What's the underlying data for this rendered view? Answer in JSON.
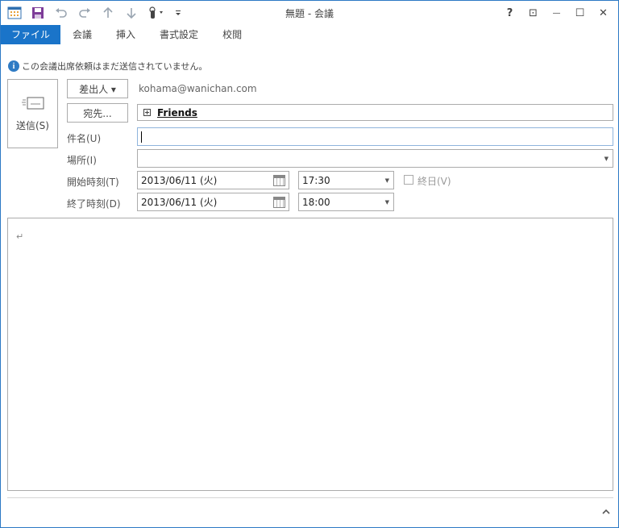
{
  "window": {
    "title": "無題 - 会議",
    "help": "?",
    "restore": "⊡",
    "minimize": "—",
    "maximize": "☐",
    "close": "✕"
  },
  "ribbon": {
    "tabs": [
      "ファイル",
      "会議",
      "挿入",
      "書式設定",
      "校閲"
    ]
  },
  "infobar": {
    "icon": "i",
    "text": "この会議出席依頼はまだ送信されていません。"
  },
  "send_button": {
    "label": "送信(S)"
  },
  "form": {
    "from_button": "差出人 ▾",
    "from_value": "kohama@wanichan.com",
    "to_button": "宛先...",
    "to_value": "Friends",
    "subject_label": "件名(U)",
    "subject_value": "",
    "location_label": "場所(I)",
    "location_value": "",
    "start_label": "開始時刻(T)",
    "start_date": "2013/06/11 (火)",
    "start_time": "17:30",
    "end_label": "終了時刻(D)",
    "end_date": "2013/06/11 (火)",
    "end_time": "18:00",
    "allday_label": "終日(V)",
    "allday_checked": false
  },
  "body": {
    "paragraph_mark": "↵"
  },
  "icons": {
    "calendar": "calendar-icon",
    "save": "save-icon",
    "undo": "undo-icon",
    "redo": "redo-icon",
    "up": "arrow-up-icon",
    "down": "arrow-down-icon",
    "touch": "touch-mode-icon",
    "customize": "customize-qat-icon",
    "collapse": "chevron-up-icon"
  },
  "colors": {
    "accent": "#1a74c9",
    "border": "#2b79c4"
  }
}
